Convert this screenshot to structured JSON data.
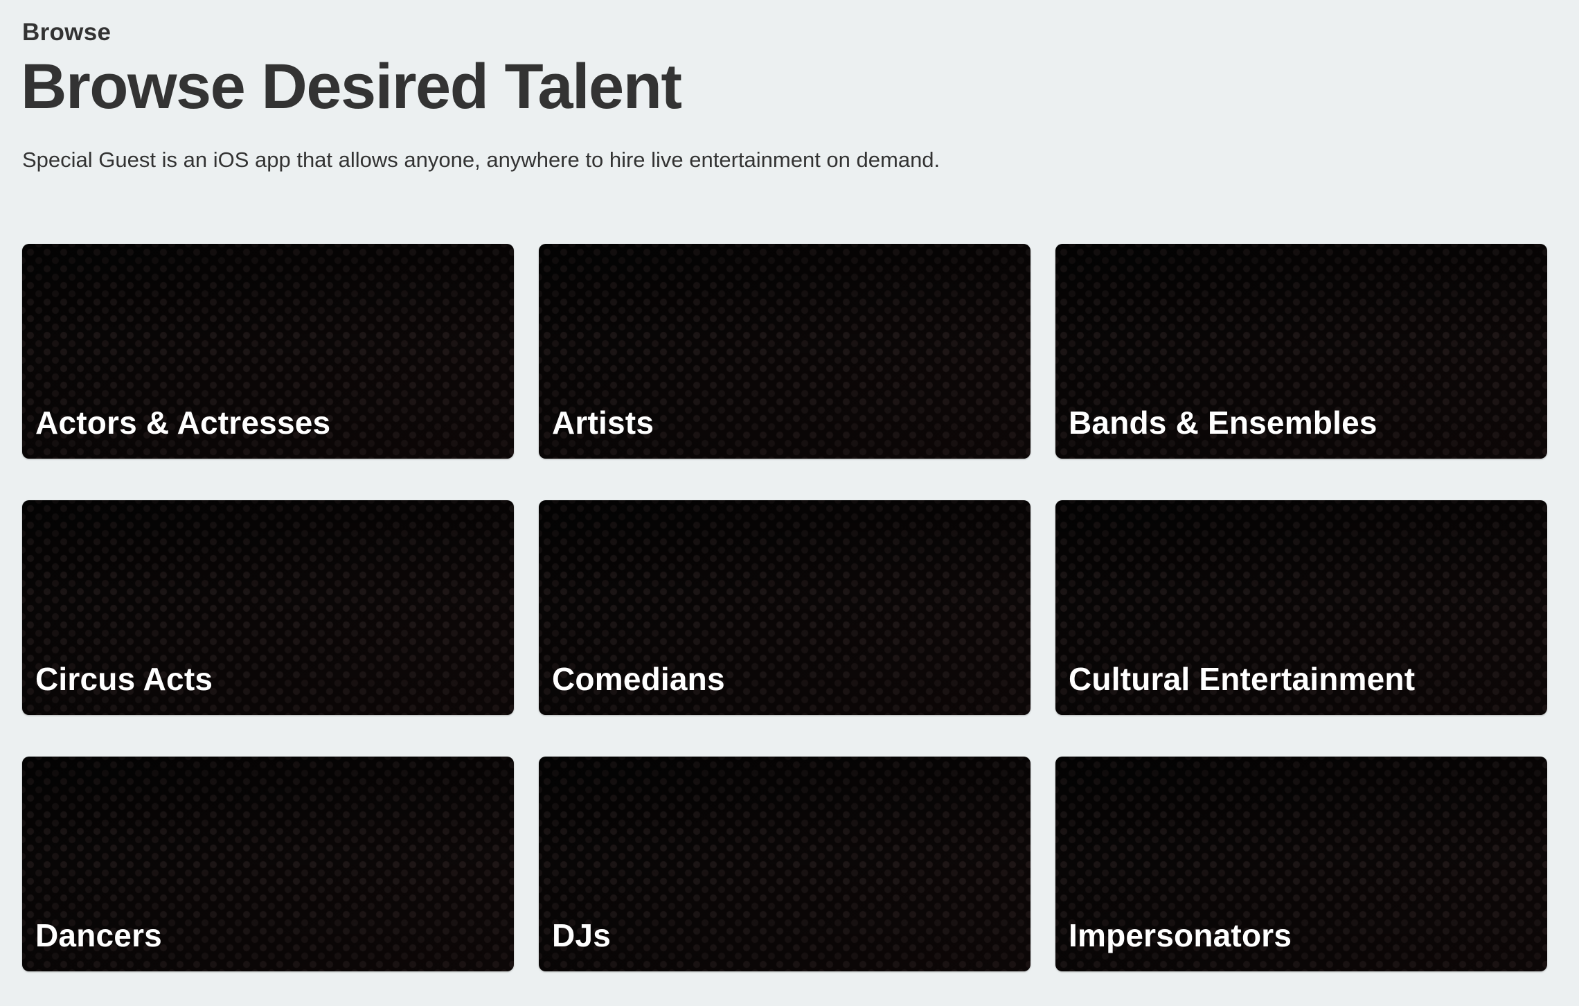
{
  "header": {
    "eyebrow": "Browse",
    "title": "Browse Desired Talent",
    "subtitle": "Special Guest is an iOS app that allows anyone, anywhere to hire live entertainment on demand."
  },
  "categories": [
    {
      "label": "Actors & Actresses"
    },
    {
      "label": "Artists"
    },
    {
      "label": "Bands & Ensembles"
    },
    {
      "label": "Circus Acts"
    },
    {
      "label": "Comedians"
    },
    {
      "label": "Cultural Entertainment"
    },
    {
      "label": "Dancers"
    },
    {
      "label": "DJs"
    },
    {
      "label": "Impersonators"
    }
  ],
  "colors": {
    "background": "#ecf0f1",
    "text": "#333333",
    "card_background": "#070505",
    "card_text": "#ffffff"
  }
}
